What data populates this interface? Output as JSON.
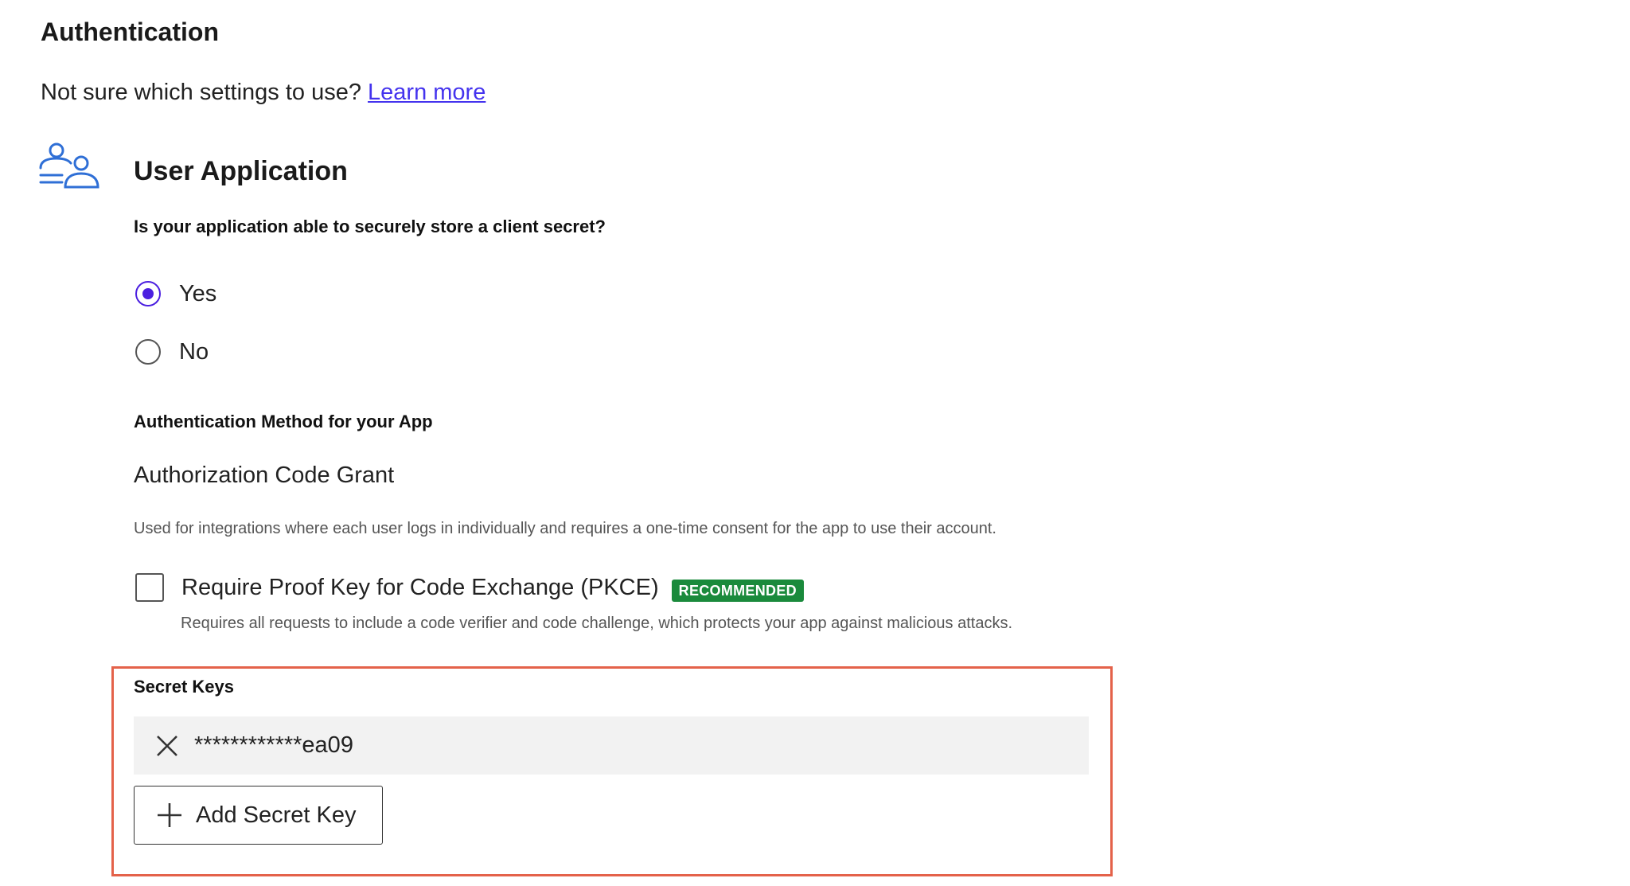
{
  "section": {
    "title": "Authentication",
    "intro_text": "Not sure which settings to use? ",
    "learn_more_link": "Learn more"
  },
  "user_application": {
    "icon": "users-icon",
    "title": "User Application",
    "question": "Is your application able to securely store a client secret?",
    "options": [
      {
        "label": "Yes",
        "selected": true
      },
      {
        "label": "No",
        "selected": false
      }
    ]
  },
  "auth_method": {
    "label": "Authentication Method for your App",
    "value": "Authorization Code Grant",
    "description": "Used for integrations where each user logs in individually and requires a one-time consent for the app to use their account."
  },
  "pkce": {
    "label": "Require Proof Key for Code Exchange (PKCE)",
    "badge": "RECOMMENDED",
    "checked": false,
    "description": "Requires all requests to include a code verifier and code challenge, which protects your app against malicious attacks."
  },
  "secret_keys": {
    "label": "Secret Keys",
    "keys": [
      {
        "masked_value": "************ea09",
        "remove_icon": "close-icon"
      }
    ],
    "add_button_label": "Add Secret Key",
    "add_icon": "plus-icon"
  },
  "colors": {
    "accent": "#4b1fe0",
    "link": "#4433ee",
    "badge_green": "#1a8a3c",
    "highlight_border": "#e4624a",
    "key_row_bg": "#f2f2f2",
    "icon_blue": "#2f6fd6"
  }
}
